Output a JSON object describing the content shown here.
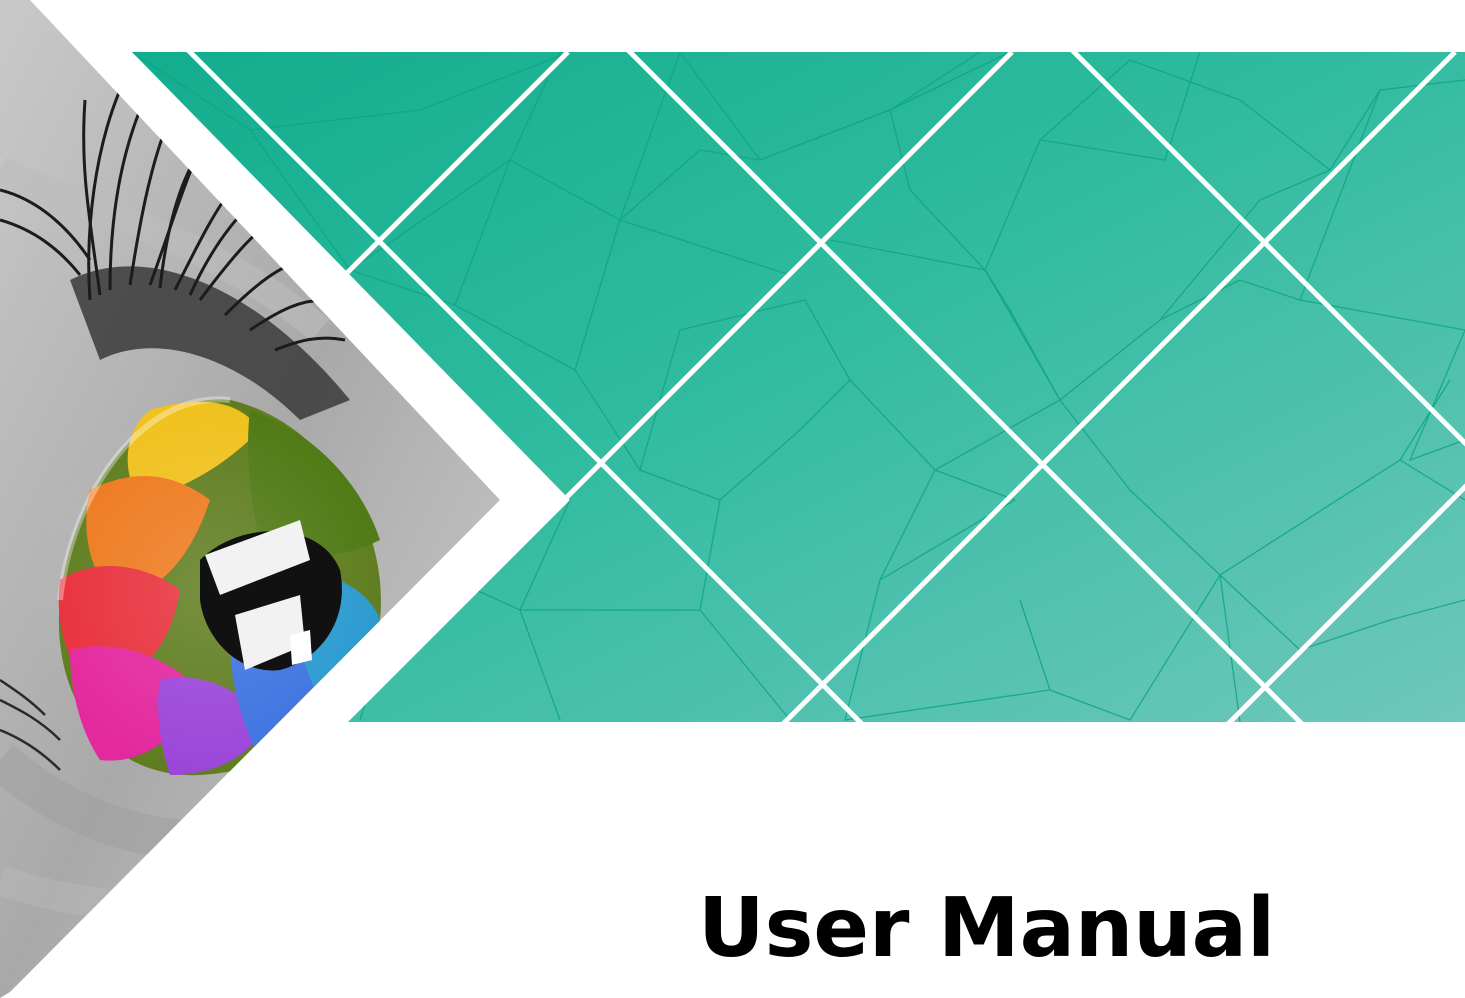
{
  "document": {
    "title": "User Manual"
  },
  "colors": {
    "background": "#ffffff",
    "title_text": "#000000",
    "banner_teal_dark": "#14b391",
    "banner_teal_mid": "#3dbea3",
    "banner_teal_light": "#6ec9b6",
    "banner_grid_lines": "#ffffff",
    "facet_lines": "#0fa584"
  },
  "images": {
    "cover_photo": "eye-with-rainbow-iris",
    "banner_pattern": "teal-diamond-lattice"
  }
}
